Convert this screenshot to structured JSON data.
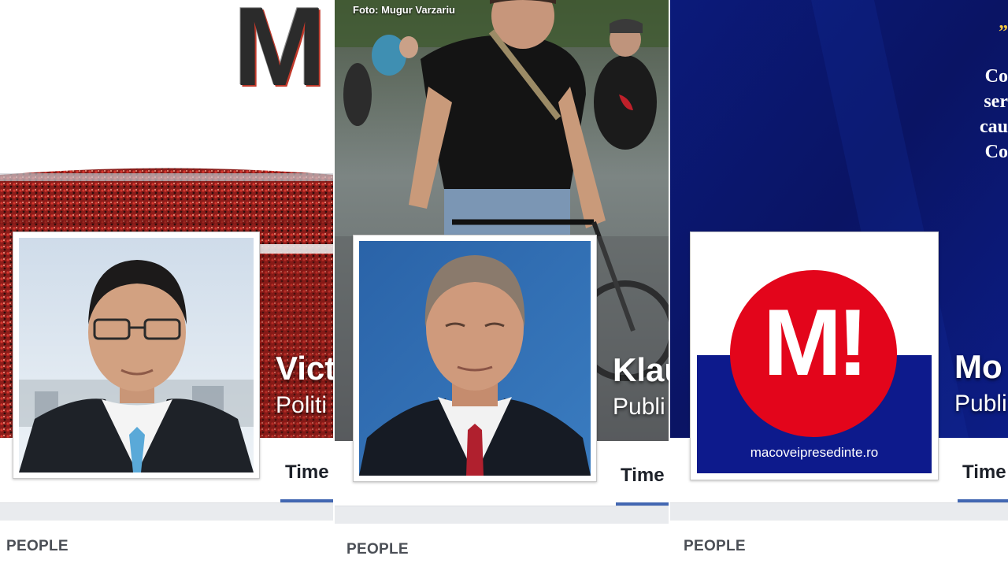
{
  "panels": [
    {
      "page_name": "Vict",
      "category": "Politi",
      "tab_label": "Time",
      "section_label": "PEOPLE",
      "cover_logo_letter": "M"
    },
    {
      "page_name": "Klau",
      "category": "Publi",
      "tab_label": "Time",
      "section_label": "PEOPLE",
      "photo_credit": "Foto: Mugur Varzariu"
    },
    {
      "page_name": "Mo",
      "category": "Publi",
      "tab_label": "Time",
      "section_label": "PEOPLE",
      "quote_lines": [
        "”",
        "Co",
        "ser",
        "cau",
        "Co"
      ],
      "logo_text": "M!",
      "logo_url": "macoveipresedinte.ro"
    }
  ],
  "colors": {
    "facebook_blue": "#4267b2",
    "page_bg": "#e9ebee",
    "logo_red": "#e3051b",
    "logo_navy": "#0d1a8c",
    "quote_gold": "#f5c842"
  }
}
